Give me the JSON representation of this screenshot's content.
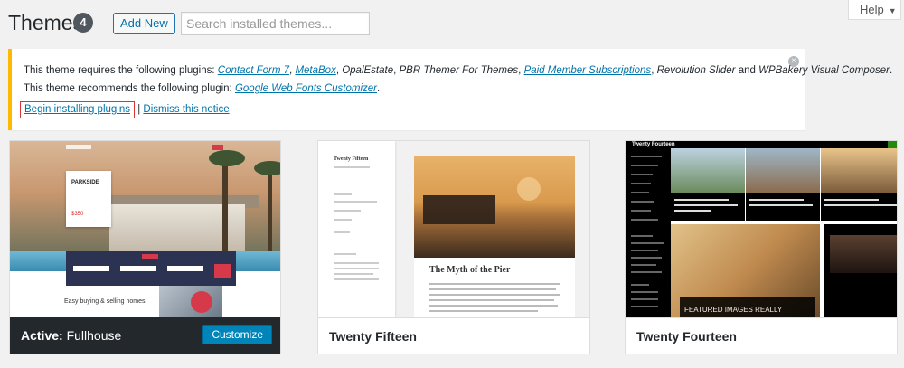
{
  "header": {
    "title": "Themes",
    "count": "4",
    "add_new_label": "Add New",
    "search_placeholder": "Search installed themes...",
    "help_label": "Help"
  },
  "notice": {
    "line1_prefix": "This theme requires the following plugins:",
    "required_plugins_linked": [
      "Contact Form 7",
      "MetaBox",
      "PBR Themer For Themes",
      "Paid Member Subscriptions"
    ],
    "required_plugins_plain": [
      "OpalEstate",
      "Revolution Slider",
      "WPBakery Visual Composer"
    ],
    "line2_prefix": "This theme recommends the following plugin:",
    "recommended_plugin": "Google Web Fonts Customizer",
    "begin_link": "Begin installing plugins",
    "separator": "|",
    "dismiss_link": "Dismiss this notice"
  },
  "themes": [
    {
      "name": "Fullhouse",
      "active": true,
      "active_label": "Active:",
      "customize_label": "Customize",
      "preview": {
        "box_title": "PARKSIDE",
        "box_price": "$350",
        "lower_heading": "Easy buying & selling homes"
      }
    },
    {
      "name": "Twenty Fifteen",
      "active": false,
      "preview": {
        "site_title": "Twenty Fifteen",
        "post_title": "The Myth of the Pier"
      }
    },
    {
      "name": "Twenty Fourteen",
      "active": false,
      "preview": {
        "site_title": "Twenty Fourteen",
        "featured_caption": "FEATURED IMAGES REALLY"
      }
    }
  ],
  "colors": {
    "accent": "#0073aa",
    "notice_border": "#ffb900",
    "active_footer": "#23282d",
    "customize_button": "#0085ba",
    "highlight_box": "#dd3333"
  }
}
